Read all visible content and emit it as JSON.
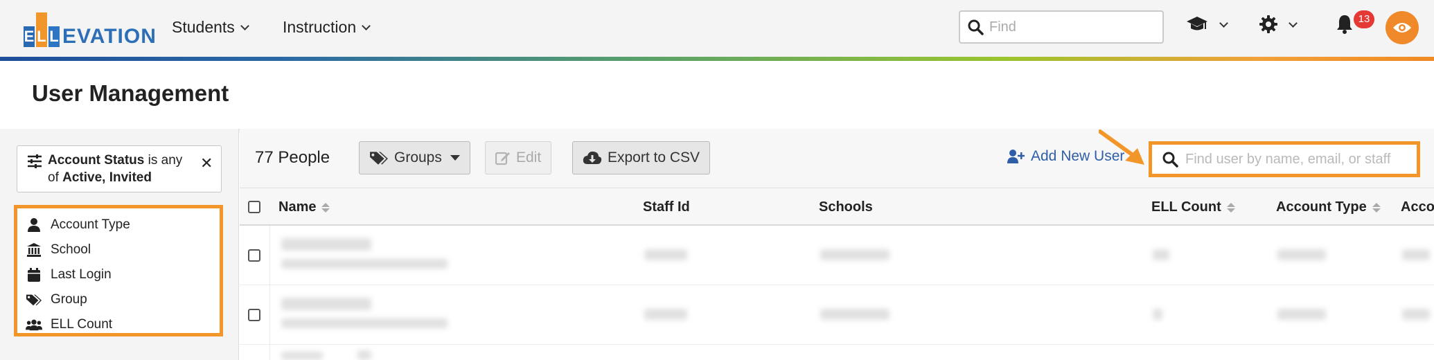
{
  "app": {
    "logo_text": "ELLEVATION",
    "logo_letters": [
      "E",
      "L",
      "L"
    ],
    "logo_rest": "EVATION"
  },
  "nav": {
    "items": [
      {
        "label": "Students"
      },
      {
        "label": "Instruction"
      }
    ],
    "find_placeholder": "Find",
    "notifications_count": "13"
  },
  "page": {
    "title": "User Management"
  },
  "sidebar": {
    "active_filter": {
      "field": "Account Status",
      "middle": " is any of ",
      "values": "Active, Invited"
    },
    "filters": [
      {
        "label": "Account Type",
        "icon": "user-icon"
      },
      {
        "label": "School",
        "icon": "school-icon"
      },
      {
        "label": "Last Login",
        "icon": "calendar-icon"
      },
      {
        "label": "Group",
        "icon": "tags-icon"
      },
      {
        "label": "ELL Count",
        "icon": "users-icon"
      }
    ]
  },
  "toolbar": {
    "people_count": "77 People",
    "groups_label": "Groups",
    "edit_label": "Edit",
    "export_label": "Export to CSV",
    "add_user_label": "Add New User",
    "search_placeholder": "Find user by name, email, or staff id"
  },
  "table": {
    "columns": [
      {
        "label": "Name",
        "sortable": true
      },
      {
        "label": "Staff Id",
        "sortable": false
      },
      {
        "label": "Schools",
        "sortable": false
      },
      {
        "label": "ELL Count",
        "sortable": true
      },
      {
        "label": "Account Type",
        "sortable": true
      },
      {
        "label": "Acco",
        "sortable": false
      }
    ]
  },
  "colors": {
    "accent_orange": "#f3962a",
    "brand_blue": "#2d6fb7",
    "link_blue": "#2f5ea8",
    "badge_red": "#e53935"
  }
}
